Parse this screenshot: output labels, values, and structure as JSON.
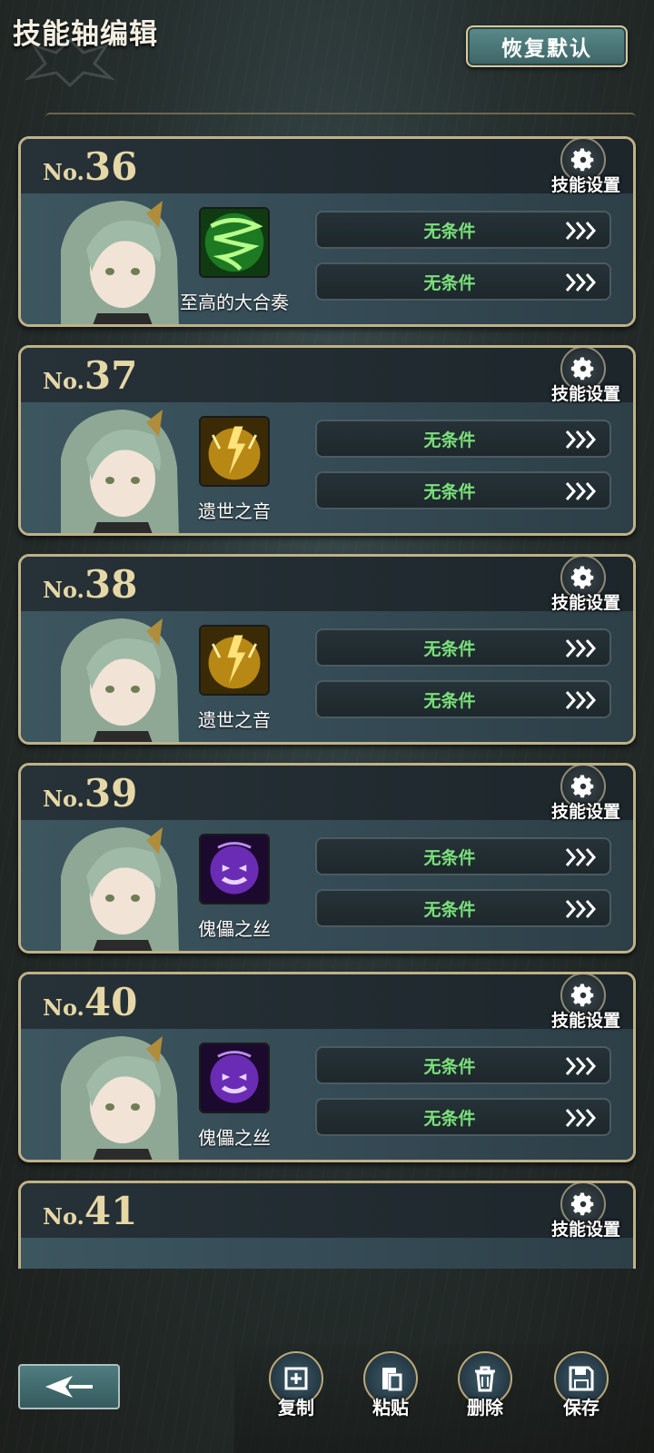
{
  "header": {
    "title": "技能轴编辑",
    "reset_label": "恢复默认"
  },
  "cards": [
    {
      "no_prefix": "No.",
      "no": "36",
      "gear_label": "技能设置",
      "skill_name": "至高的大合奏",
      "skill_icon": "green-tornado-skill-icon",
      "conditions": [
        "无条件",
        "无条件"
      ]
    },
    {
      "no_prefix": "No.",
      "no": "37",
      "gear_label": "技能设置",
      "skill_name": "遗世之音",
      "skill_icon": "golden-lightning-skill-icon",
      "conditions": [
        "无条件",
        "无条件"
      ]
    },
    {
      "no_prefix": "No.",
      "no": "38",
      "gear_label": "技能设置",
      "skill_name": "遗世之音",
      "skill_icon": "golden-lightning-skill-icon",
      "conditions": [
        "无条件",
        "无条件"
      ]
    },
    {
      "no_prefix": "No.",
      "no": "39",
      "gear_label": "技能设置",
      "skill_name": "傀儡之丝",
      "skill_icon": "purple-puppet-skill-icon",
      "conditions": [
        "无条件",
        "无条件"
      ]
    },
    {
      "no_prefix": "No.",
      "no": "40",
      "gear_label": "技能设置",
      "skill_name": "傀儡之丝",
      "skill_icon": "purple-puppet-skill-icon",
      "conditions": [
        "无条件",
        "无条件"
      ]
    },
    {
      "no_prefix": "No.",
      "no": "41",
      "gear_label": "技能设置"
    }
  ],
  "toolbar": {
    "copy": "复制",
    "paste": "粘贴",
    "delete": "删除",
    "save": "保存"
  },
  "colors": {
    "condition_text": "#7ae07a",
    "card_border": "#bfb188",
    "accent_teal": "#4f7d80"
  }
}
